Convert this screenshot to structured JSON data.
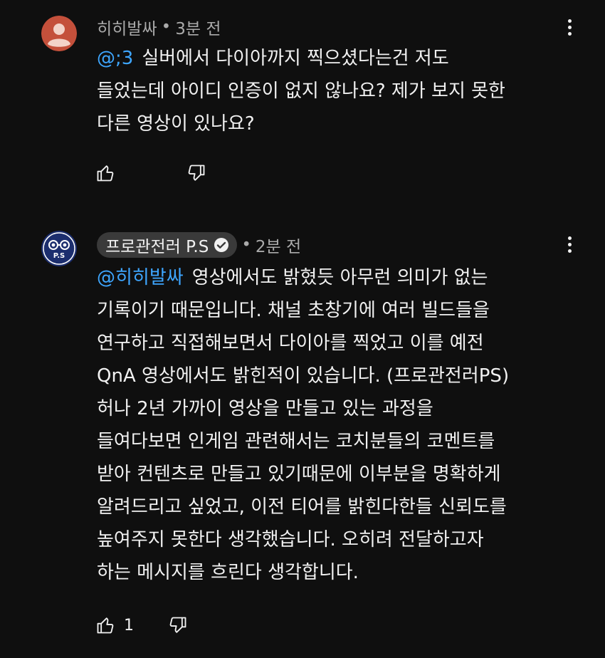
{
  "comments": [
    {
      "author": "히히발싸",
      "verified": false,
      "time": "3분 전",
      "mention": "@;3",
      "text": "실버에서 다이아까지 찍으셨다는건 저도\n들었는데 아이디 인증이 없지 않나요? 제가 보지 못한\n다른 영상이 있나요?",
      "likes": "",
      "avatar_color": "#c4503b"
    },
    {
      "author": "프로관전러 P.S",
      "verified": true,
      "time": "2분 전",
      "mention": "@히히발싸",
      "text": "영상에서도 밝혔듯 아무런 의미가 없는\n기록이기 때문입니다. 채널 초창기에 여러 빌드들을\n연구하고 직접해보면서 다이아를 찍었고 이를 예전\nQnA 영상에서도 밝힌적이 있습니다. (프로관전러PS)\n허나 2년 가까이 영상을 만들고 있는 과정을\n들여다보면 인게임 관련해서는 코치분들의 코멘트를\n받아 컨텐츠로 만들고 있기때문에 이부분을 명확하게\n알려드리고 싶었고, 이전 티어를 밝힌다한들 신뢰도를\n높여주지 못한다 생각했습니다. 오히려 전달하고자\n하는 메시지를 흐린다 생각합니다.",
      "likes": "1",
      "avatar_text": "P.S",
      "avatar_color": "#1c2e6e"
    }
  ],
  "separator": "•",
  "icons": {
    "like": "thumb-up-icon",
    "dislike": "thumb-down-icon",
    "menu": "more-vert-icon",
    "verified": "verified-check-icon"
  },
  "colors": {
    "background": "#0f0f0f",
    "text": "#f1f1f1",
    "meta": "#aaaaaa",
    "mention": "#3ea6ff",
    "chip": "#3a3a3a"
  }
}
